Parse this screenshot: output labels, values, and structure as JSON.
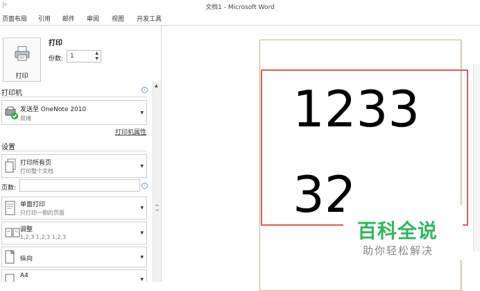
{
  "window": {
    "title": "文档1 - Microsoft Word",
    "quick_access": "|▿"
  },
  "ribbon": {
    "tabs": [
      "页面布局",
      "引用",
      "邮件",
      "审阅",
      "视图",
      "开发工具"
    ]
  },
  "print": {
    "button_label": "打印",
    "heading": "打印",
    "copies_label": "份数:",
    "copies_value": "1"
  },
  "printer": {
    "section": "打印机",
    "name": "发送至 OneNote 2010",
    "status": "就绪",
    "properties_link": "打印机属性"
  },
  "settings": {
    "section": "设置",
    "range_title": "打印所有页",
    "range_sub": "打印整个文档",
    "pages_label": "页数:",
    "pages_value": "",
    "sides_title": "单面打印",
    "sides_sub": "只打印一侧的页面",
    "collate_title": "调整",
    "collate_sub": "1,2,3    1,2,3    1,2,3",
    "orientation_title": "纵向",
    "paper_title": "A4"
  },
  "preview": {
    "line1": "1233",
    "line2": "32"
  },
  "watermark": {
    "line1": "百科全说",
    "line2": "助你轻松解决"
  },
  "colors": {
    "highlight": "#e05a5a",
    "watermark_green": "#2eb85c"
  }
}
